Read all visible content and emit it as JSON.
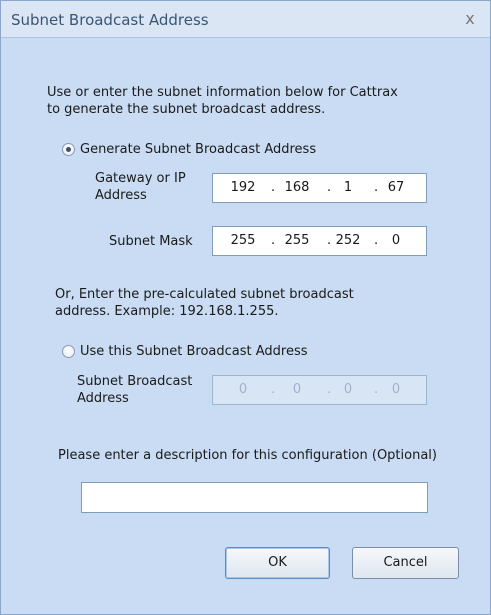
{
  "dialog": {
    "title": "Subnet Broadcast Address",
    "close_glyph": "x",
    "intro_line1": "Use or enter the subnet information below for Cattrax",
    "intro_line2": "to generate the subnet broadcast address.",
    "option_generate": {
      "label": "Generate Subnet Broadcast Address",
      "selected": true,
      "gateway_label_line1": "Gateway or IP",
      "gateway_label_line2": "Address",
      "gateway": [
        "192",
        "168",
        "1",
        "67"
      ],
      "mask_label": "Subnet Mask",
      "mask": [
        "255",
        "255",
        "252",
        "0"
      ]
    },
    "or_line1": "Or, Enter the pre-calculated  subnet broadcast",
    "or_line2": "address. Example: 192.168.1.255.",
    "option_use": {
      "label": "Use this Subnet Broadcast Address",
      "selected": false,
      "broadcast_label_line1": "Subnet Broadcast",
      "broadcast_label_line2": "Address",
      "broadcast": [
        "0",
        "0",
        "0",
        "0"
      ]
    },
    "description_prompt": "Please enter a description for this configuration (Optional)",
    "description_value": "",
    "ok_label": "OK",
    "cancel_label": "Cancel"
  }
}
